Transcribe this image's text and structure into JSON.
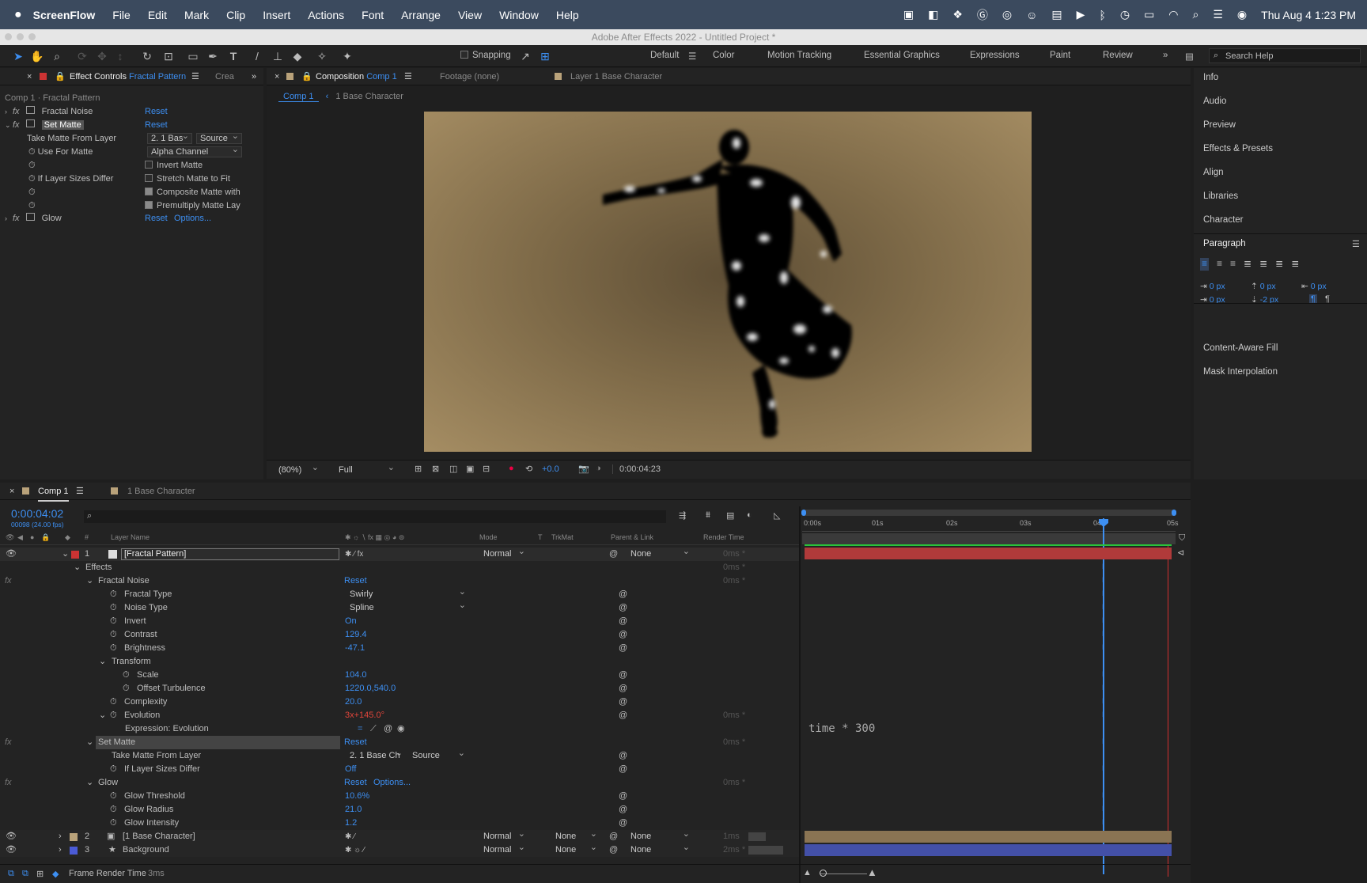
{
  "menubar": {
    "apple": "",
    "app": "ScreenFlow",
    "items": [
      "File",
      "Edit",
      "Mark",
      "Clip",
      "Insert",
      "Actions",
      "Font",
      "Arrange",
      "View",
      "Window",
      "Help"
    ],
    "clock": "Thu Aug 4  1:23 PM"
  },
  "window_title": "Adobe After Effects 2022 - Untitled Project *",
  "toolbar": {
    "snapping": "Snapping",
    "workspaces": [
      "Default",
      "Color",
      "Motion Tracking",
      "Essential Graphics",
      "Expressions",
      "Paint",
      "Review"
    ],
    "search_placeholder": "Search Help"
  },
  "effect_controls": {
    "tab_label": "Effect Controls",
    "tab_target": "Fractal Pattern",
    "tab2": "Crea",
    "breadcrumb": "Comp 1 · Fractal Pattern",
    "effects": [
      {
        "name": "Fractal Noise",
        "reset": "Reset"
      },
      {
        "name": "Set Matte",
        "reset": "Reset"
      },
      {
        "name": "Glow",
        "reset": "Reset",
        "options": "Options..."
      }
    ],
    "set_matte": {
      "take_matte_label": "Take Matte From Layer",
      "take_matte_value": "2. 1 Bas",
      "source": "Source",
      "use_for_matte_label": "Use For Matte",
      "use_for_matte_value": "Alpha Channel",
      "invert_matte": "Invert Matte",
      "if_sizes_differ": "If Layer Sizes Differ",
      "stretch": "Stretch Matte to Fit",
      "composite": "Composite Matte with",
      "premultiply": "Premultiply Matte Lay"
    }
  },
  "comp_panel": {
    "tab_label": "Composition",
    "tab_target": "Comp 1",
    "footage": "Footage (none)",
    "layer": "Layer 1 Base Character",
    "crumb1": "Comp 1",
    "crumb2": "1 Base Character",
    "zoom": "(80%)",
    "resolution": "Full",
    "exposure": "+0.0",
    "timecode": "0:00:04:23"
  },
  "right_panel": {
    "items": [
      "Info",
      "Audio",
      "Preview",
      "Effects & Presets",
      "Align",
      "Libraries",
      "Character"
    ],
    "paragraph": "Paragraph",
    "px_values": [
      "0 px",
      "0 px",
      "0 px",
      "0 px",
      "-2 px"
    ],
    "bottom_items": [
      "Content-Aware Fill",
      "Mask Interpolation"
    ]
  },
  "timeline": {
    "tab": "Comp 1",
    "tab2": "1 Base Character",
    "timecode": "0:00:04:02",
    "frames": "00098 (24.00 fps)",
    "columns": {
      "hash": "#",
      "layer_name": "Layer Name",
      "mode": "Mode",
      "t": "T",
      "trkmat": "TrkMat",
      "parent": "Parent & Link",
      "render": "Render Time"
    },
    "ruler": [
      "0:00s",
      "01s",
      "02s",
      "03s",
      "04",
      "05s"
    ],
    "layers": [
      {
        "num": "1",
        "name": "[Fractal Pattern]",
        "mode": "Normal",
        "parent": "None",
        "render": "0ms *"
      },
      {
        "num": "2",
        "name": "[1 Base Character]",
        "mode": "Normal",
        "trkmat": "None",
        "parent": "None",
        "render": "1ms"
      },
      {
        "num": "3",
        "name": "Background",
        "mode": "Normal",
        "trkmat": "None",
        "parent": "None",
        "render": "2ms *"
      }
    ],
    "effects_label": "Effects",
    "fractal_noise": "Fractal Noise",
    "reset": "Reset",
    "props": [
      {
        "name": "Fractal Type",
        "value": "Swirly"
      },
      {
        "name": "Noise Type",
        "value": "Spline"
      },
      {
        "name": "Invert",
        "value": "On"
      },
      {
        "name": "Contrast",
        "value": "129.4"
      },
      {
        "name": "Brightness",
        "value": "-47.1"
      }
    ],
    "transform": "Transform",
    "scale": {
      "name": "Scale",
      "value": "104.0"
    },
    "offset": {
      "name": "Offset Turbulence",
      "value": "1220.0,540.0"
    },
    "complexity": {
      "name": "Complexity",
      "value": "20.0"
    },
    "evolution": {
      "name": "Evolution",
      "value": "3x+145.0°"
    },
    "expr_label": "Expression: Evolution",
    "expression": "time * 300",
    "set_matte": "Set Matte",
    "take_matte": {
      "name": "Take Matte From Layer",
      "value": "2. 1 Base Ch",
      "source": "Source"
    },
    "sizes_differ": {
      "name": "If Layer Sizes Differ",
      "value": "Off"
    },
    "glow": "Glow",
    "glow_options": "Options...",
    "glow_props": [
      {
        "name": "Glow Threshold",
        "value": "10.6%"
      },
      {
        "name": "Glow Radius",
        "value": "21.0"
      },
      {
        "name": "Glow Intensity",
        "value": "1.2"
      }
    ],
    "render_ms": "0ms *",
    "footer": "Frame Render Time",
    "footer_val": "3ms"
  }
}
